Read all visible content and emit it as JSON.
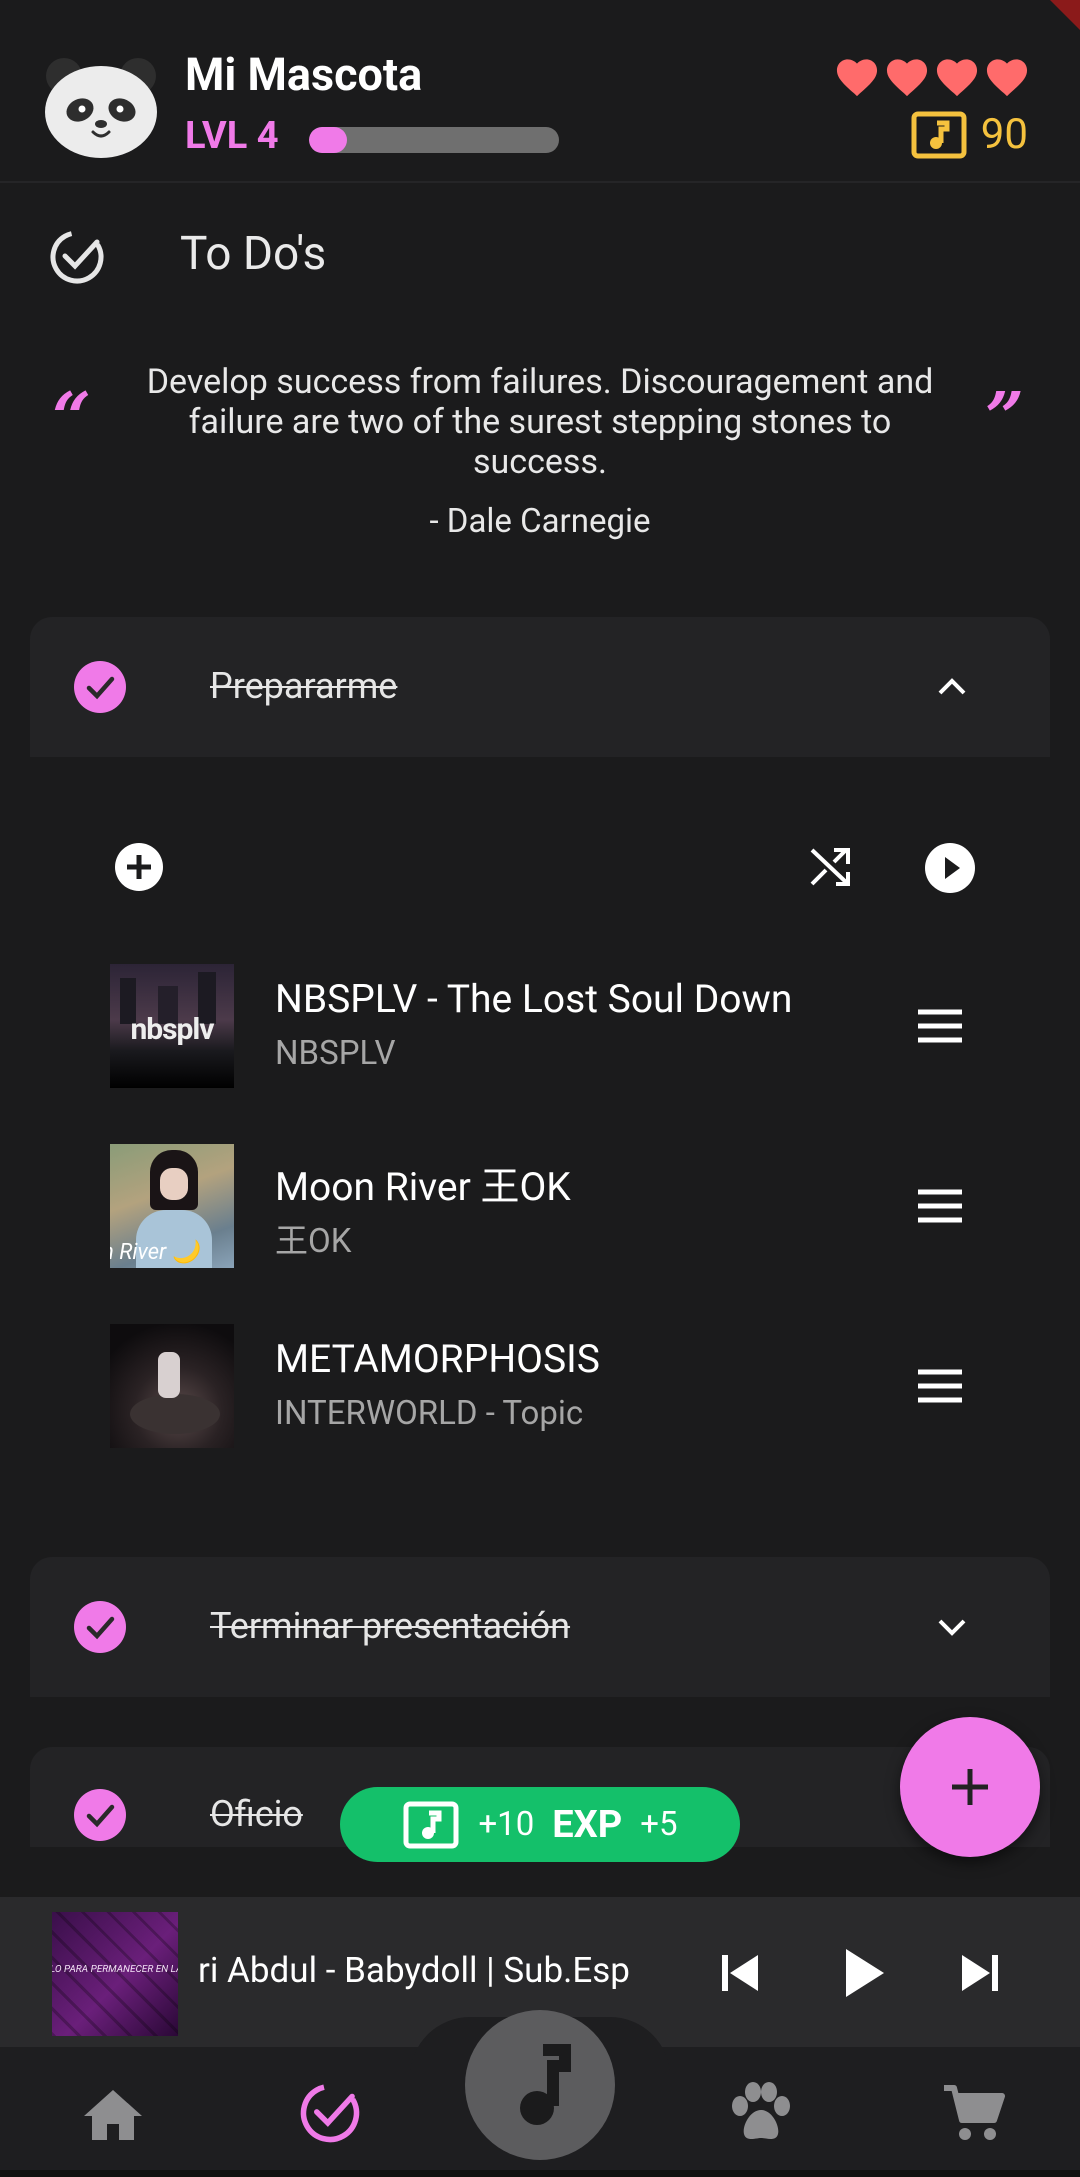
{
  "header": {
    "pet_name": "Mi Mascota",
    "level": "LVL 4",
    "xp_progress": 0.15,
    "hearts": 4,
    "coins": "90"
  },
  "section": {
    "title": "To Do's"
  },
  "quote": {
    "text": "Develop success from failures. Discouragement and failure are two of the surest stepping stones to success.",
    "author": "- Dale Carnegie"
  },
  "tasks": [
    {
      "title": "Prepararme",
      "completed": true,
      "expanded": true
    },
    {
      "title": "Terminar presentación",
      "completed": true,
      "expanded": false
    },
    {
      "title": "Oficio",
      "completed": true,
      "expanded": false
    }
  ],
  "playlist": [
    {
      "title": "NBSPLV - The Lost Soul Down",
      "artist": "NBSPLV",
      "thumb_text": "nbsplv"
    },
    {
      "title": "Moon River  王OK",
      "artist": "王OK",
      "thumb_text": "n River 🌙"
    },
    {
      "title": "METAMORPHOSIS",
      "artist": "INTERWORLD - Topic"
    }
  ],
  "toast": {
    "coins": "+10",
    "exp_label": "EXP",
    "exp": "+5"
  },
  "now_playing": {
    "title": "ri Abdul  - Babydoll | Sub.Esp",
    "thumb_text": "LO PARA PERMANECER EN LA CI"
  },
  "colors": {
    "accent": "#f07ae8",
    "gold": "#f5c23e",
    "heart": "#ff6b6b",
    "toast": "#14c06a",
    "background": "#1b1b1c"
  },
  "nav": [
    "home-icon",
    "check-circle-icon",
    "music-note-icon",
    "paw-icon",
    "cart-icon"
  ]
}
